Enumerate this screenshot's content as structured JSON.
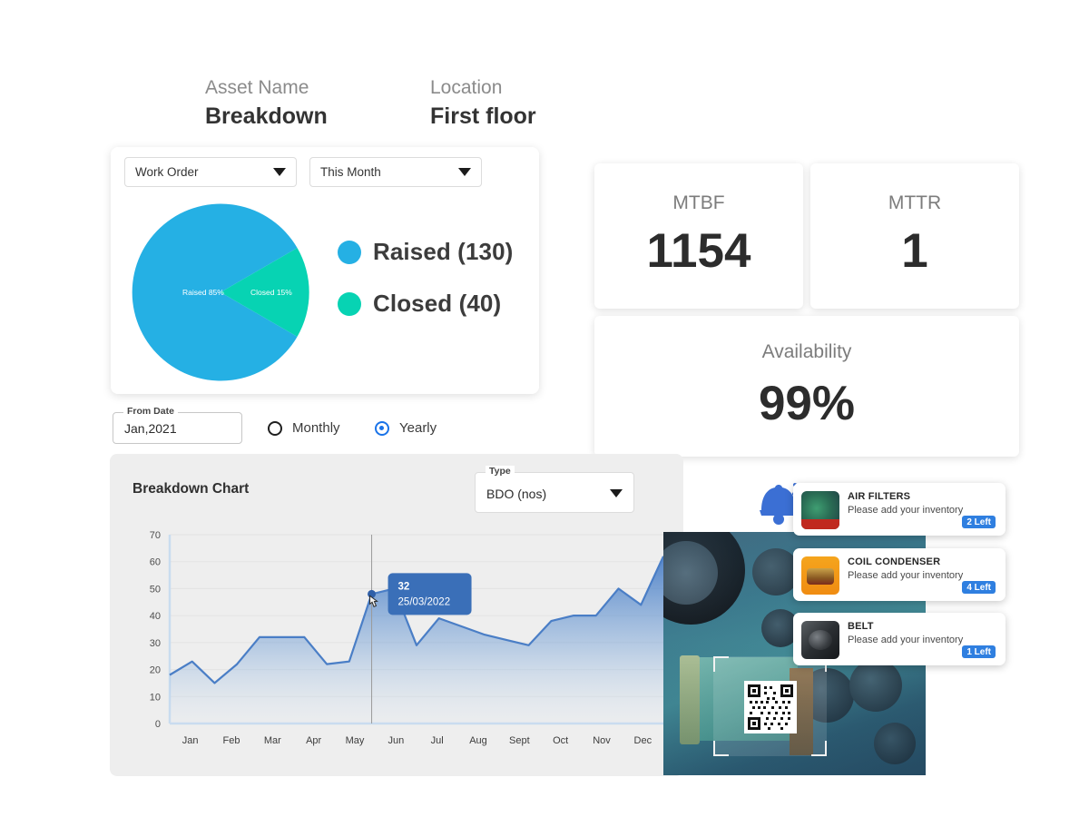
{
  "header": {
    "asset_name_label": "Asset Name",
    "asset_name_value": "Breakdown",
    "location_label": "Location",
    "location_value": "First floor"
  },
  "pie_card": {
    "filter_type": "Work Order",
    "filter_period": "This Month",
    "caret_icon": "chevron-down-icon",
    "legend": [
      {
        "label": "Raised (130)",
        "color": "#25b0e4"
      },
      {
        "label": "Closed (40)",
        "color": "#07d3b3"
      }
    ]
  },
  "kpis": [
    {
      "label": "MTBF",
      "value": "1154"
    },
    {
      "label": "MTTR",
      "value": "1"
    },
    {
      "label": "Availability",
      "value": "99%"
    }
  ],
  "controls": {
    "from_date_legend": "From Date",
    "from_date_value": "Jan,2021",
    "radio_monthly": "Monthly",
    "radio_yearly": "Yearly",
    "selected_period": "Yearly"
  },
  "breakdown_panel": {
    "title": "Breakdown Chart",
    "type_legend": "Type",
    "type_value": "BDO (nos)",
    "caret_icon": "chevron-down-icon"
  },
  "photo": {
    "name": "machine-photo",
    "qr_overlay": "qr-scan-overlay"
  },
  "notifications": {
    "bell_icon": "bell-ringing-icon",
    "items": [
      {
        "title": "AIR FILTERS",
        "message": "Please add your inventory",
        "badge": "2 Left",
        "thumb": "air-filter-thumbnail"
      },
      {
        "title": "COIL CONDENSER",
        "message": "Please add your inventory",
        "badge": "4 Left",
        "thumb": "coil-condenser-thumbnail"
      },
      {
        "title": "BELT",
        "message": "Please add your inventory",
        "badge": "1 Left",
        "thumb": "belt-thumbnail"
      }
    ]
  },
  "chart_data": [
    {
      "type": "pie",
      "title": "Work Order status",
      "labels": [
        "Raised",
        "Closed"
      ],
      "values": [
        130,
        40
      ],
      "percents": [
        85,
        15
      ],
      "slice_labels": [
        "Raised 85%",
        "Closed 15%"
      ],
      "colors": [
        "#25b0e4",
        "#07d3b3"
      ],
      "legend": "right"
    },
    {
      "type": "area",
      "title": "Breakdown Chart",
      "xlabel": "",
      "ylabel": "",
      "ylim": [
        0,
        70
      ],
      "yticks": [
        0,
        10,
        20,
        30,
        40,
        50,
        60,
        70
      ],
      "grid": true,
      "categories": [
        "Jan",
        "Feb",
        "Mar",
        "Apr",
        "May",
        "Jun",
        "Jul",
        "Aug",
        "Sept",
        "Oct",
        "Nov",
        "Dec"
      ],
      "series": [
        {
          "name": "BDO (nos)",
          "values": [
            18,
            23,
            15,
            22,
            32,
            32,
            32,
            22,
            23,
            48,
            50,
            29,
            39,
            36,
            33,
            31,
            29,
            38,
            40,
            40,
            50,
            44,
            62
          ]
        }
      ],
      "tooltip": {
        "value": "32",
        "date": "25/03/2022",
        "x_month": "Jun"
      }
    }
  ]
}
